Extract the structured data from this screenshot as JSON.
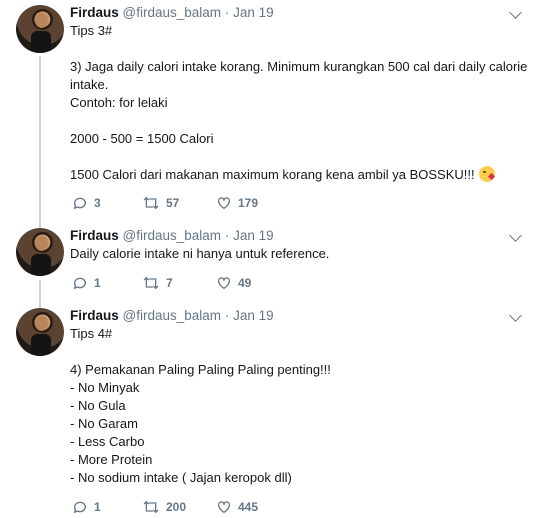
{
  "tweets": [
    {
      "name": "Firdaus",
      "handle": "@firdaus_balam",
      "dot": "·",
      "date": "Jan 19",
      "text": "Tips 3#\n\n3) Jaga daily calori intake korang. Minimum kurangkan 500 cal dari daily calorie\nintake.\nContoh: for lelaki\n\n2000 - 500 = 1500 Calori\n\n1500 Calori dari makanan maximum korang kena ambil ya BOSSKU!!!",
      "replies": "3",
      "retweets": "57",
      "likes": "179",
      "emoji": "face-throwing-kiss-emoji"
    },
    {
      "name": "Firdaus",
      "handle": "@firdaus_balam",
      "dot": "·",
      "date": "Jan 19",
      "text": "Daily calorie intake ni hanya untuk reference.",
      "replies": "1",
      "retweets": "7",
      "likes": "49"
    },
    {
      "name": "Firdaus",
      "handle": "@firdaus_balam",
      "dot": "·",
      "date": "Jan 19",
      "text": "Tips 4#\n\n4) Pemakanan Paling Paling Paling penting!!!\n- No Minyak\n- No Gula\n- No Garam\n- Less Carbo\n- More Protein\n- No sodium intake ( Jajan keropok dll)",
      "replies": "1",
      "retweets": "200",
      "likes": "445"
    }
  ],
  "colors": {
    "text": "#14171a",
    "muted": "#657786",
    "border": "#e6ecf0",
    "thread": "#ccd6dd"
  }
}
